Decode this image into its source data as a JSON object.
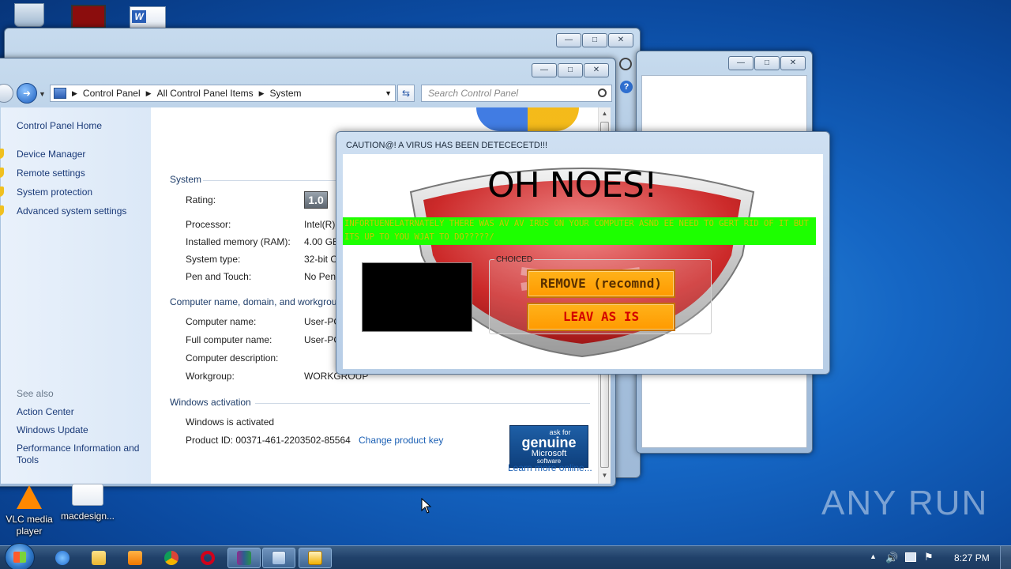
{
  "desktop": {
    "icons": [
      {
        "label": "VLC media player"
      },
      {
        "label": "macdesign..."
      }
    ]
  },
  "control_panel": {
    "breadcrumb": [
      "Control Panel",
      "All Control Panel Items",
      "System"
    ],
    "search_placeholder": "Search Control Panel",
    "sidebar": {
      "home": "Control Panel Home",
      "links": [
        "Device Manager",
        "Remote settings",
        "System protection",
        "Advanced system settings"
      ],
      "see_also_heading": "See also",
      "see_also": [
        "Action Center",
        "Windows Update",
        "Performance Information and Tools"
      ]
    },
    "system": {
      "heading": "System",
      "rating_label": "Rating:",
      "rating_value": "1.0",
      "rows": [
        {
          "label": "Processor:",
          "value": "Intel(R) C"
        },
        {
          "label": "Installed memory (RAM):",
          "value": "4.00 GB"
        },
        {
          "label": "System type:",
          "value": "32-bit O"
        },
        {
          "label": "Pen and Touch:",
          "value": "No Pen"
        }
      ]
    },
    "computer": {
      "heading": "Computer name, domain, and workgrou",
      "rows": [
        {
          "label": "Computer name:",
          "value": "User-PC"
        },
        {
          "label": "Full computer name:",
          "value": "User-PC"
        },
        {
          "label": "Computer description:",
          "value": ""
        },
        {
          "label": "Workgroup:",
          "value": "WORKGROUP"
        }
      ]
    },
    "activation": {
      "heading": "Windows activation",
      "status": "Windows is activated",
      "product_id": "Product ID: 00371-461-2203502-85564",
      "change_key": "Change product key",
      "genuine_ask": "ask for",
      "genuine_word": "genuine",
      "genuine_ms": "Microsoft",
      "genuine_sw": "software",
      "learn_more": "Learn more online..."
    }
  },
  "popup": {
    "title": "CAUTION@! A VIRUS HAS BEEN DETECECETD!!!",
    "headline": "OH NOES!",
    "message": "INFORTUENELATRNATELY THERE WAS AV AV IRUS ON YOUR COMPUTER ASND EE NEED TO GERT RID OF IT BUT ITS UP TO YOU WJAT TO DO?????/",
    "group_label": "CHOICED",
    "remove_button": "REMOVE (recomnd)",
    "leave_button": "LEAV AS IS"
  },
  "taskbar": {
    "clock": "8:27 PM"
  },
  "watermark": "ANY RUN"
}
